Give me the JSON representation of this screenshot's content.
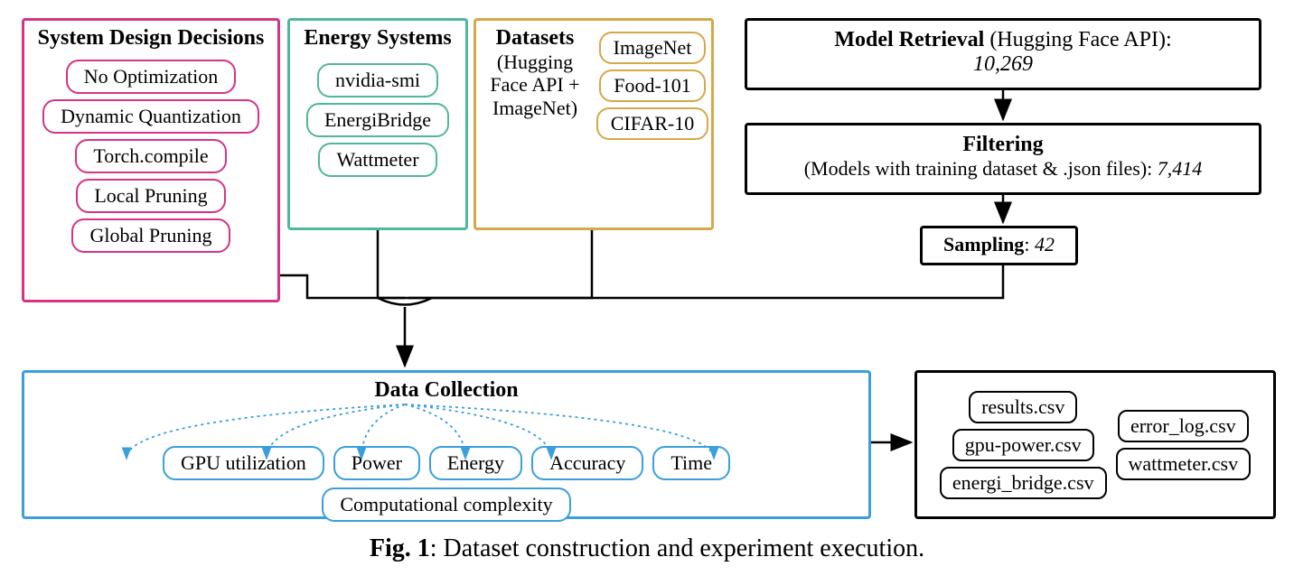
{
  "sdd": {
    "title": "System Design Decisions",
    "items": [
      "No Optimization",
      "Dynamic Quantization",
      "Torch.compile",
      "Local Pruning",
      "Global Pruning"
    ]
  },
  "es": {
    "title": "Energy  Systems",
    "items": [
      "nvidia-smi",
      "EnergiBridge",
      "Wattmeter"
    ]
  },
  "ds": {
    "title": "Datasets",
    "subtitle": "(Hugging Face API + ImageNet)",
    "items": [
      "ImageNet",
      "Food-101",
      "CIFAR-10"
    ]
  },
  "pipeline": {
    "model_retrieval_label": "Model Retrieval",
    "model_retrieval_src": " (Hugging Face API):",
    "model_retrieval_count": "10,269",
    "filtering_label": "Filtering",
    "filtering_desc": "(Models with training dataset & .json files): ",
    "filtering_count": "7,414",
    "sampling_label": "Sampling",
    "sampling_count": "42"
  },
  "dc": {
    "title": "Data Collection",
    "metrics": [
      "GPU utilization",
      "Power",
      "Energy",
      "Accuracy",
      "Time",
      "Computational complexity"
    ]
  },
  "out": {
    "files_col1": [
      "results.csv",
      "gpu-power.csv",
      "energi_bridge.csv"
    ],
    "files_col2": [
      "error_log.csv",
      "wattmeter.csv"
    ]
  },
  "caption_prefix": "Fig. 1",
  "caption_text": ": Dataset construction and experiment execution."
}
